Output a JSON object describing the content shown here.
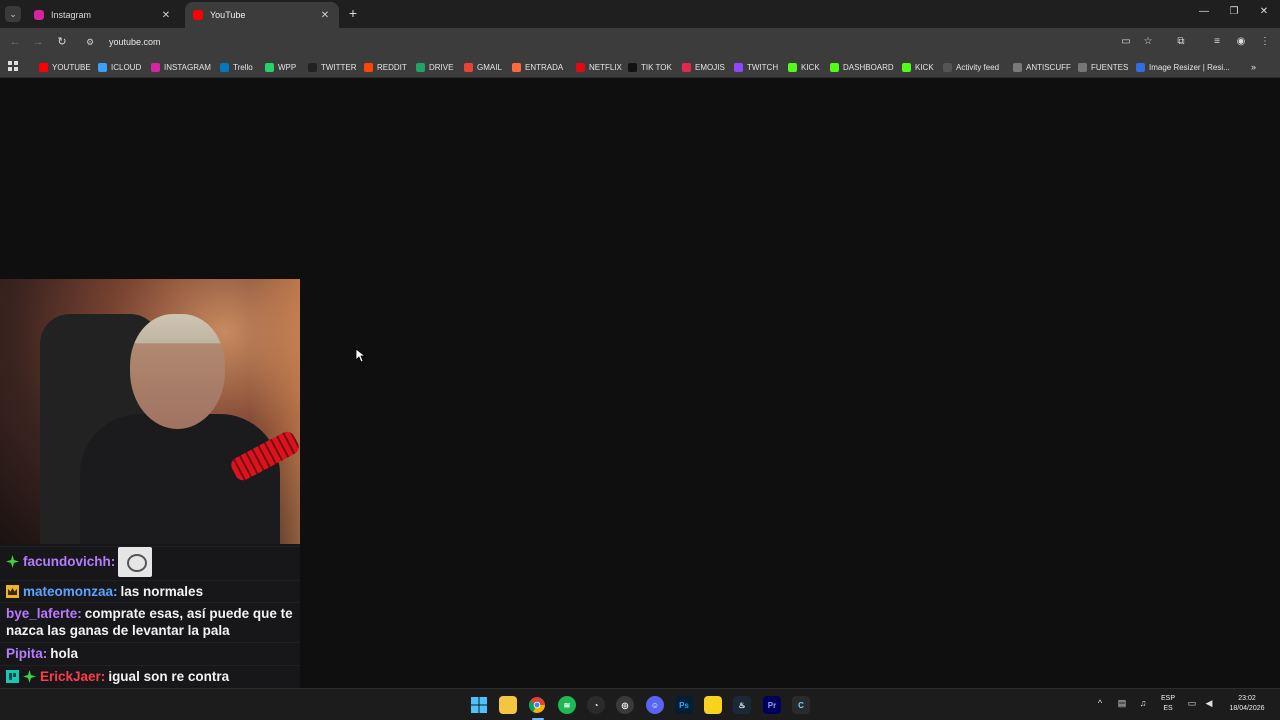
{
  "browser": {
    "tabs": [
      {
        "title": "Instagram",
        "active": false,
        "favicon_color": "#d6249f"
      },
      {
        "title": "YouTube",
        "active": true,
        "favicon_color": "#ff0000"
      }
    ],
    "url": "youtube.com"
  },
  "bookmarks": [
    {
      "label": "YOUTUBE",
      "icon": "youtube-icon",
      "color": "#ff0000"
    },
    {
      "label": "ICLOUD",
      "icon": "icloud-icon",
      "color": "#3aa0ff"
    },
    {
      "label": "INSTAGRAM",
      "icon": "instagram-icon",
      "color": "#d6249f"
    },
    {
      "label": "Trello",
      "icon": "trello-icon",
      "color": "#0079bf"
    },
    {
      "label": "WPP",
      "icon": "whatsapp-icon",
      "color": "#25d366"
    },
    {
      "label": "TWITTER",
      "icon": "x-icon",
      "color": "#222222"
    },
    {
      "label": "REDDIT",
      "icon": "reddit-icon",
      "color": "#ff4500"
    },
    {
      "label": "DRIVE",
      "icon": "drive-icon",
      "color": "#1fa463"
    },
    {
      "label": "GMAIL",
      "icon": "gmail-icon",
      "color": "#ea4335"
    },
    {
      "label": "ENTRADA",
      "icon": "link-icon",
      "color": "#ff6a3d"
    },
    {
      "label": "NETFLIX",
      "icon": "netflix-icon",
      "color": "#e50914"
    },
    {
      "label": "TIK TOK",
      "icon": "tiktok-icon",
      "color": "#111111"
    },
    {
      "label": "EMOJIS",
      "icon": "emoji-icon",
      "color": "#e3284b"
    },
    {
      "label": "TWITCH",
      "icon": "twitch-icon",
      "color": "#9146ff"
    },
    {
      "label": "KICK",
      "icon": "kick-icon",
      "color": "#53fc18"
    },
    {
      "label": "DASHBOARD",
      "icon": "kick-icon",
      "color": "#53fc18"
    },
    {
      "label": "KICK",
      "icon": "kick-icon",
      "color": "#53fc18"
    },
    {
      "label": "Activity feed",
      "icon": "anchor-icon",
      "color": "#555555"
    },
    {
      "label": "ANTISCUFF",
      "icon": "antiscuff-icon",
      "color": "#7a7a7a"
    },
    {
      "label": "FUENTES",
      "icon": "globe-icon",
      "color": "#777777"
    },
    {
      "label": "Image Resizer | Resi...",
      "icon": "resizer-icon",
      "color": "#2f6de1"
    }
  ],
  "chat": {
    "messages": [
      {
        "user": "facundovichh:",
        "text": "",
        "user_color": "#b77bff",
        "badges": [
          "green-gem"
        ],
        "emote": true
      },
      {
        "user": "mateomonzaa:",
        "text": "las normales",
        "user_color": "#5aa4ff",
        "badges": [
          "gold-crown"
        ],
        "emote": false
      },
      {
        "user": "bye_laferte:",
        "text": "comprate esas, así puede que te nazca las ganas de levantar la pala",
        "user_color": "#b77bff",
        "badges": [],
        "emote": false
      },
      {
        "user": "Pipita:",
        "text": "hola",
        "user_color": "#b77bff",
        "badges": [],
        "emote": false
      },
      {
        "user": "ErickJaer:",
        "text": "igual son re contra incomodas, tipo para usarlas todo el día sol horribles",
        "user_color": "#ff3b4a",
        "badges": [
          "teal-badge",
          "green-gem"
        ],
        "emote": false
      }
    ]
  },
  "taskbar": {
    "language_line1": "ESP",
    "language_line2": "ES",
    "time": "23:02",
    "date": "18/04/2026",
    "apps": [
      "start-icon",
      "file-explorer-icon",
      "chrome-icon",
      "spotify-icon",
      "obs-icon",
      "app-icon",
      "discord-icon",
      "photoshop-icon",
      "sticky-notes-icon",
      "steam-icon",
      "premiere-icon",
      "ccleaner-icon"
    ]
  }
}
